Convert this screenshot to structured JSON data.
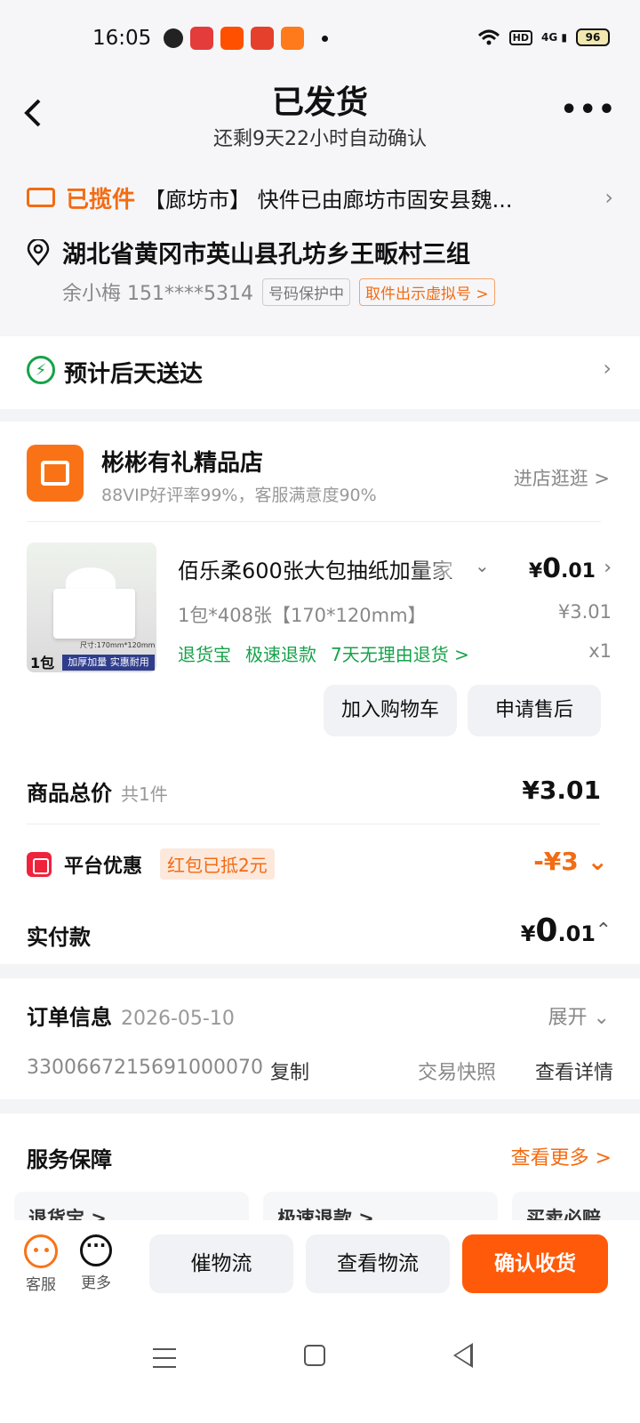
{
  "status_bar": {
    "time": "16:05",
    "signal_text": "4G",
    "hd": "HD",
    "battery": "96"
  },
  "header": {
    "title": "已发货",
    "subtitle": "还剩9天22小时自动确认"
  },
  "shipping": {
    "status": "已揽件",
    "text": "【廊坊市】 快件已由廊坊市固安县魏..."
  },
  "address": {
    "line": "湖北省黄冈市英山县孔坊乡王畈村三组",
    "contact": "余小梅 151****5314",
    "privacy_tag": "号码保护中",
    "virtual_number_tag": "取件出示虚拟号 >"
  },
  "delivery": {
    "estimate": "预计后天送达"
  },
  "shop": {
    "name": "彬彬有礼精品店",
    "rating": "88VIP好评率99%，客服满意度90%",
    "enter_label": "进店逛逛 >"
  },
  "product": {
    "name": "佰乐柔600张大包抽纸加量家",
    "price_symbol": "¥",
    "price_int": "0",
    "price_dec": ".01",
    "spec": "1包*408张【170*120mm】",
    "original_price": "¥3.01",
    "tags": [
      "退货宝",
      "极速退款",
      "7天无理由退货 >"
    ],
    "quantity": "x1",
    "image_pack_label": "1包",
    "image_band_text": "加厚加量 实惠耐用",
    "image_size_text": "尺寸:170mm*120mm"
  },
  "actions": {
    "add_cart": "加入购物车",
    "after_sale": "申请售后"
  },
  "summary": {
    "total_label": "商品总价",
    "total_count": "共1件",
    "total_value": "¥3.01",
    "promo_label": "平台优惠",
    "promo_tag": "红包已抵2元",
    "promo_value": "-¥3",
    "paid_label": "实付款",
    "paid_symbol": "¥",
    "paid_int": "0",
    "paid_dec": ".01"
  },
  "order": {
    "title": "订单信息",
    "date": "2026-05-10",
    "expand": "展开",
    "number": "3300667215691000070",
    "copy": "复制",
    "snapshot": "交易快照",
    "details": "查看详情"
  },
  "service": {
    "title": "服务保障",
    "more": "查看更多 >",
    "cards": [
      "退货宝 >",
      "极速退款 >",
      "买卖必赔"
    ]
  },
  "bottom_bar": {
    "service_label": "客服",
    "more_label": "更多",
    "urge": "催物流",
    "track": "查看物流",
    "confirm": "确认收货"
  },
  "colors": {
    "accent": "#ff5a0a",
    "orange_text": "#f36b13",
    "green": "#16a34a",
    "red": "#ef233c"
  }
}
